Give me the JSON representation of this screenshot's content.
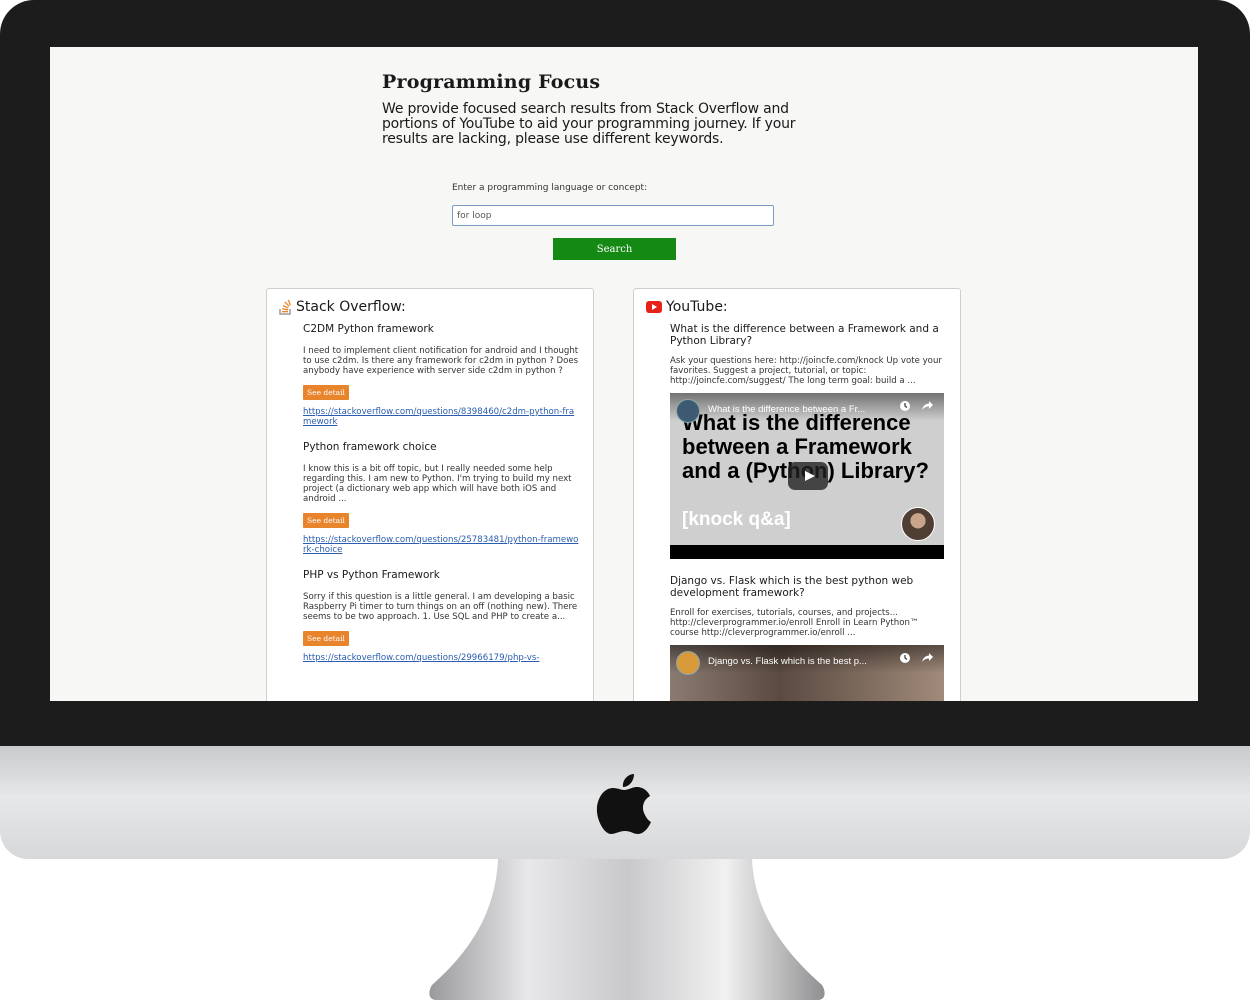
{
  "page": {
    "title": "Programming Focus",
    "description": "We provide focused search results from Stack Overflow and portions of YouTube to aid your programming journey. If your results are lacking, please use different keywords."
  },
  "search": {
    "label": "Enter a programming language or concept:",
    "value": "for loop",
    "button_label": "Search"
  },
  "stack_overflow": {
    "title": "Stack Overflow:",
    "icon": "stack-overflow-icon",
    "items": [
      {
        "title": "C2DM Python framework",
        "excerpt": "I need to implement client notification for android and I thought to use c2dm. Is there any framework for c2dm in python ? Does anybody have experience with server side c2dm in python ?",
        "button_label": "See detail",
        "link": "https://stackoverflow.com/questions/8398460/c2dm-python-framework"
      },
      {
        "title": "Python framework choice",
        "excerpt": "I know this is a bit off topic, but I really needed some help regarding this. I am new to Python. I'm trying to build my next project (a dictionary web app which will have both iOS and android ...",
        "button_label": "See detail",
        "link": "https://stackoverflow.com/questions/25783481/python-framework-choice"
      },
      {
        "title": "PHP vs Python Framework",
        "excerpt": "Sorry if this question is a little general. I am developing a basic Raspberry Pi timer to turn things on an off (nothing new). There seems to be two approach. 1. Use SQL and PHP to create a...",
        "button_label": "See detail",
        "link": "https://stackoverflow.com/questions/29966179/php-vs-"
      }
    ]
  },
  "youtube": {
    "title": "YouTube:",
    "icon": "youtube-icon",
    "items": [
      {
        "title": "What is the difference between a Framework and a Python Library?",
        "excerpt": "Ask your questions here: http://joincfe.com/knock Up vote your favorites. Suggest a project, tutorial, or topic: http://joincfe.com/suggest/ The long term goal: build a ...",
        "video_title": "What is the difference between a Fr...",
        "thumbnail_text": "What is the difference between a Framework and a (Python) Library?",
        "thumbnail_subtext": "[knock q&a]"
      },
      {
        "title": "Django vs. Flask which is the best python web development framework?",
        "excerpt": "Enroll for exercises, tutorials, courses, and projects... http://cleverprogrammer.io/enroll Enroll in Learn Python™ course http://cleverprogrammer.io/enroll ...",
        "video_title": "Django vs. Flask which is the best p..."
      }
    ]
  },
  "colors": {
    "search_button": "#148a14",
    "detail_button": "#e8842c",
    "link": "#2a5db0",
    "monitor_bezel": "#1c1c1c"
  }
}
